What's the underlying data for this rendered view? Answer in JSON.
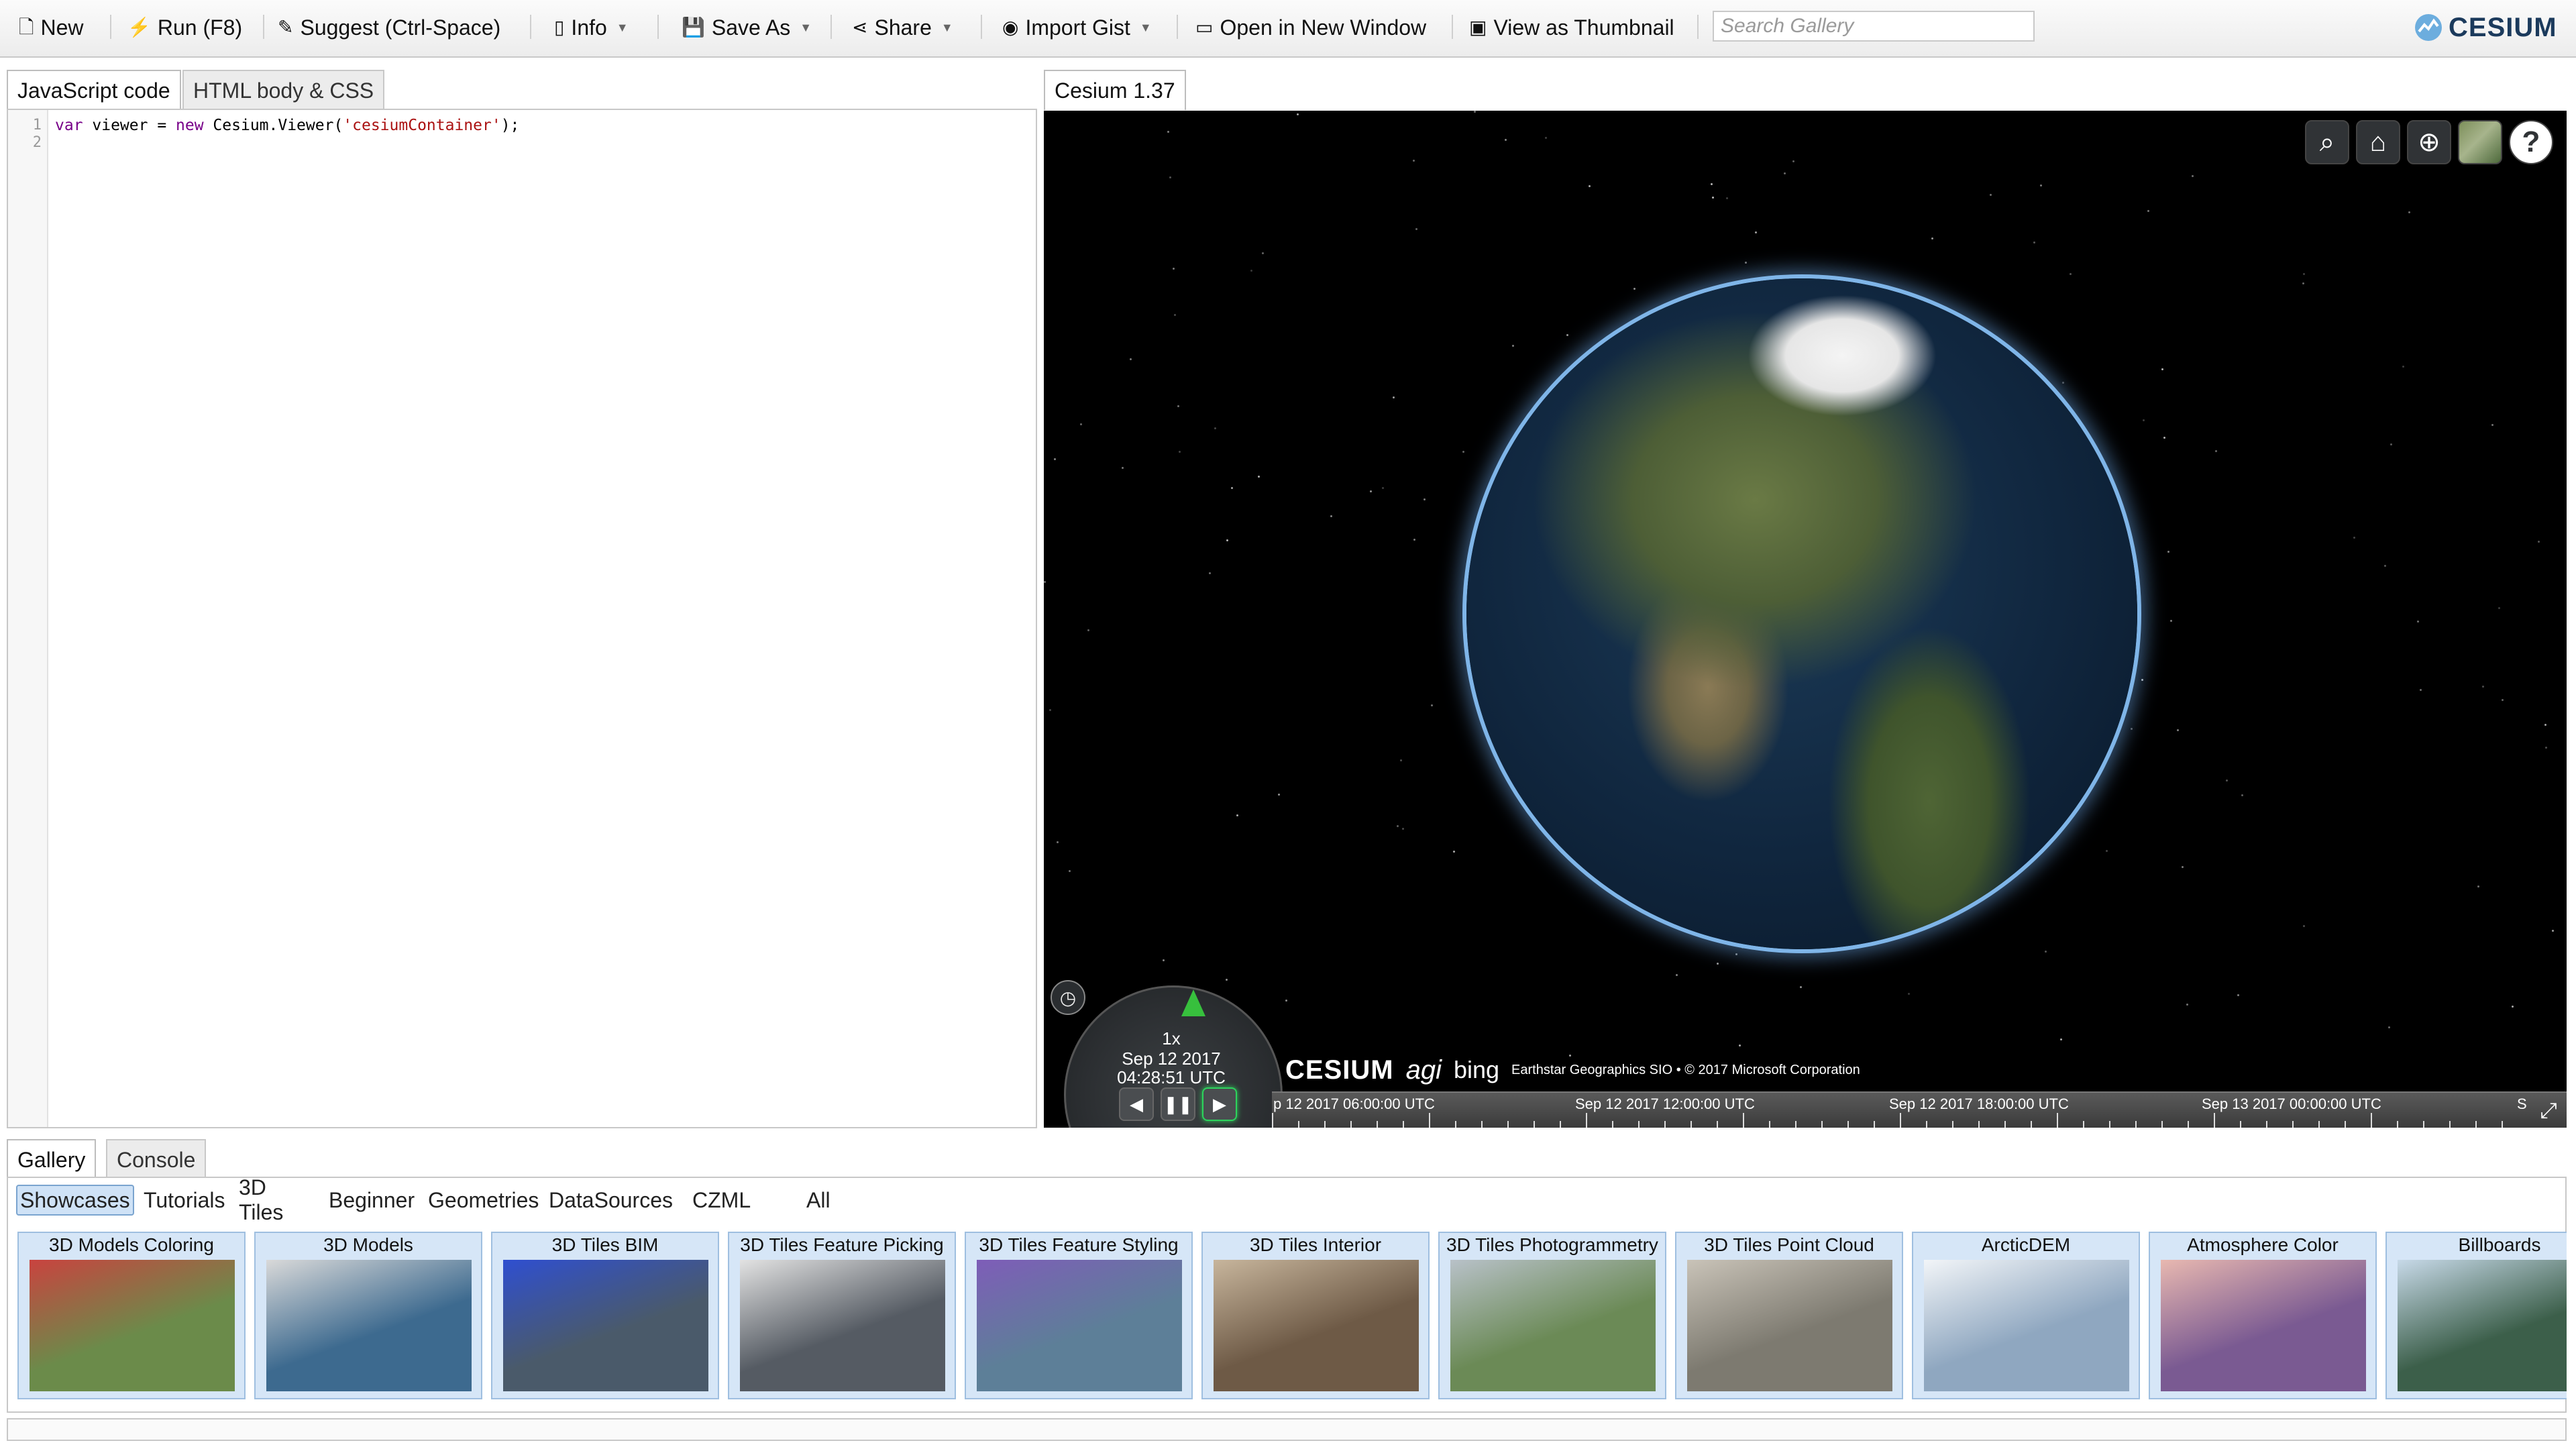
{
  "toolbar": {
    "new": "New",
    "run": "Run (F8)",
    "suggest": "Suggest (Ctrl-Space)",
    "info": "Info",
    "save_as": "Save As",
    "share": "Share",
    "import_gist": "Import Gist",
    "open_new_window": "Open in New Window",
    "view_thumbnail": "View as Thumbnail",
    "search_placeholder": "Search Gallery",
    "brand": "CESIUM"
  },
  "editor": {
    "tabs": [
      "JavaScript code",
      "HTML body & CSS"
    ],
    "line_numbers": [
      "1",
      "2"
    ],
    "code": {
      "kw1": "var",
      "p1": " viewer = ",
      "kw2": "new",
      "p2": " Cesium.Viewer(",
      "str": "'cesiumContainer'",
      "p3": ");"
    }
  },
  "viewer": {
    "tab": "Cesium 1.37",
    "toolbar_icons": [
      "search-icon",
      "home-icon",
      "globe-icon",
      "imagery-layer-icon",
      "help-icon"
    ],
    "animation": {
      "speed": "1x",
      "date": "Sep 12 2017",
      "time": "04:28:51 UTC"
    },
    "credits": {
      "cesium": "CESIUM",
      "agi": "agi",
      "bing": "bing",
      "text": "Earthstar Geographics SIO • © 2017 Microsoft Corporation"
    },
    "timeline": {
      "labels": [
        "p 12 2017 06:00:00 UTC",
        "Sep 12 2017 12:00:00 UTC",
        "Sep 12 2017 18:00:00 UTC",
        "Sep 13 2017 00:00:00 UTC",
        "S"
      ]
    }
  },
  "gallery": {
    "tabs": [
      "Gallery",
      "Console"
    ],
    "categories": [
      "Showcases",
      "Tutorials",
      "3D Tiles",
      "Beginner",
      "Geometries",
      "DataSources",
      "CZML",
      "All"
    ],
    "items": [
      {
        "label": "3D Models Coloring",
        "c1": "#6b8b4a",
        "c2": "#c9433f"
      },
      {
        "label": "3D Models",
        "c1": "#3d6a8f",
        "c2": "#d9d9d9"
      },
      {
        "label": "3D Tiles BIM",
        "c1": "#4a5a6a",
        "c2": "#2f4fd0"
      },
      {
        "label": "3D Tiles Feature Picking",
        "c1": "#555b63",
        "c2": "#e2e2e2"
      },
      {
        "label": "3D Tiles Feature Styling",
        "c1": "#5d7f98",
        "c2": "#7e5db8"
      },
      {
        "label": "3D Tiles Interior",
        "c1": "#6e5a46",
        "c2": "#c7b59c"
      },
      {
        "label": "3D Tiles Photogrammetry",
        "c1": "#6b8a56",
        "c2": "#b8c1c8"
      },
      {
        "label": "3D Tiles Point Cloud",
        "c1": "#7d7a70",
        "c2": "#c9c3b8"
      },
      {
        "label": "ArcticDEM",
        "c1": "#8fa7c0",
        "c2": "#f2f5f8"
      },
      {
        "label": "Atmosphere Color",
        "c1": "#7a5a92",
        "c2": "#e8b8b0"
      },
      {
        "label": "Billboards",
        "c1": "#3c5f4a",
        "c2": "#c7d9e8"
      }
    ]
  }
}
